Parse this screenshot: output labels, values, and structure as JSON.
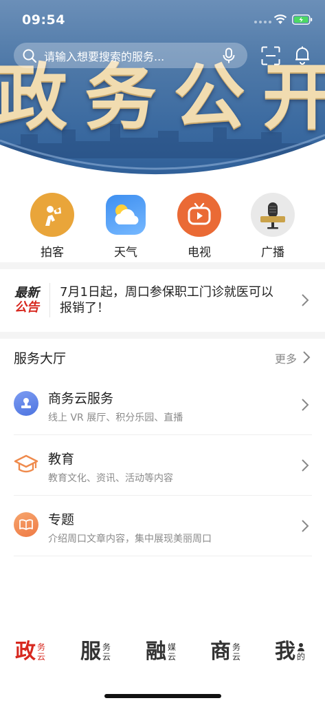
{
  "status_bar": {
    "time": "09:54"
  },
  "hero": {
    "banner_text": "政务公开"
  },
  "search": {
    "placeholder": "请输入想要搜索的服务..."
  },
  "quick_links": [
    {
      "label": "拍客",
      "icon": "camera-person-icon"
    },
    {
      "label": "天气",
      "icon": "weather-icon"
    },
    {
      "label": "电视",
      "icon": "tv-icon"
    },
    {
      "label": "广播",
      "icon": "radio-microphone-icon"
    }
  ],
  "notice": {
    "tag_line1": "最新",
    "tag_line2": "公告",
    "text": "7月1日起，周口参保职工门诊就医可以报销了！"
  },
  "service_hall": {
    "title": "服务大厅",
    "more": "更多",
    "items": [
      {
        "title": "商务云服务",
        "subtitle": "线上 VR 展厅、积分乐园、直播",
        "icon": "stamp-icon"
      },
      {
        "title": "教育",
        "subtitle": "教育文化、资讯、活动等内容",
        "icon": "graduation-cap-icon"
      },
      {
        "title": "专题",
        "subtitle": "介绍周口文章内容，集中展现美丽周口",
        "icon": "book-icon"
      }
    ]
  },
  "tabs": [
    {
      "big": "政",
      "small1": "务",
      "small2": "云",
      "active": true
    },
    {
      "big": "服",
      "small1": "务",
      "small2": "云",
      "active": false
    },
    {
      "big": "融",
      "small1": "媒",
      "small2": "云",
      "active": false
    },
    {
      "big": "商",
      "small1": "务",
      "small2": "云",
      "active": false
    },
    {
      "big": "我",
      "small1": "",
      "small2": "的",
      "active": false
    }
  ],
  "colors": {
    "accent": "#d7281f",
    "hero_blue": "#3b6aa0"
  }
}
